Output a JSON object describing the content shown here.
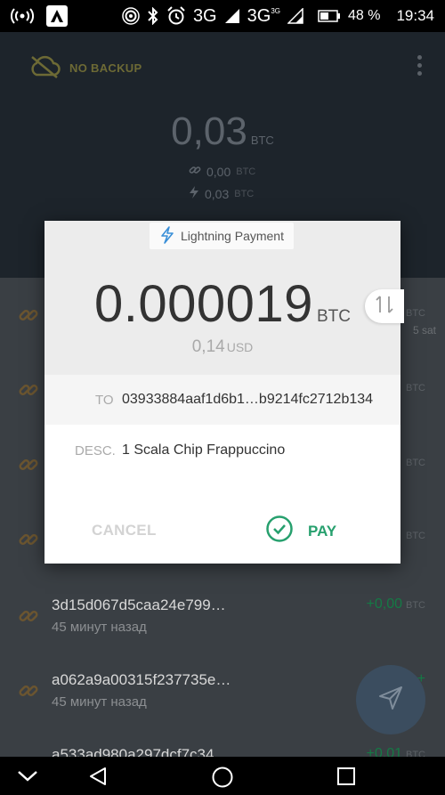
{
  "status_bar": {
    "network_1": "3G",
    "network_2": "3G",
    "network_2_sup": "3G",
    "battery": "48 %",
    "time": "19:34"
  },
  "header": {
    "backup_label": "NO BACKUP",
    "balance_main": "0,03",
    "balance_unit": "BTC",
    "onchain_balance": "0,00",
    "onchain_unit": "BTC",
    "lightning_balance": "0,03",
    "lightning_unit": "BTC"
  },
  "transactions": [
    {
      "id": "",
      "time": "",
      "amount": "",
      "unit": "BTC",
      "extra": "5 sat"
    },
    {
      "id": "",
      "time": "",
      "amount": "",
      "unit": "BTC"
    },
    {
      "id": "",
      "time": "",
      "amount": "",
      "unit": "BTC"
    },
    {
      "id": "",
      "time": "",
      "amount": "",
      "unit": "BTC"
    },
    {
      "id": "3d15d067d5caa24e799…",
      "time": "45 минут назад",
      "amount": "+0,00",
      "unit": "BTC"
    },
    {
      "id": "a062a9a00315f237735e…",
      "time": "45 минут назад",
      "amount": "+",
      "unit": ""
    },
    {
      "id": "a533ad980a297dcf7c34…",
      "time": "",
      "amount": "+0,01",
      "unit": "BTC"
    }
  ],
  "dialog": {
    "type_label": "Lightning Payment",
    "amount": "0.000019",
    "amount_unit": "BTC",
    "fiat_amount": "0,14",
    "fiat_unit": "USD",
    "to_label": "TO",
    "to_value": "03933884aaf1d6b1…b9214fc2712b134",
    "desc_label": "DESC.",
    "desc_value": "1 Scala Chip Frappuccino",
    "cancel_label": "CANCEL",
    "pay_label": "PAY"
  },
  "colors": {
    "accent_green": "#27a06e",
    "lightning_blue": "#3a8fd8",
    "link_orange": "#b8862a"
  }
}
